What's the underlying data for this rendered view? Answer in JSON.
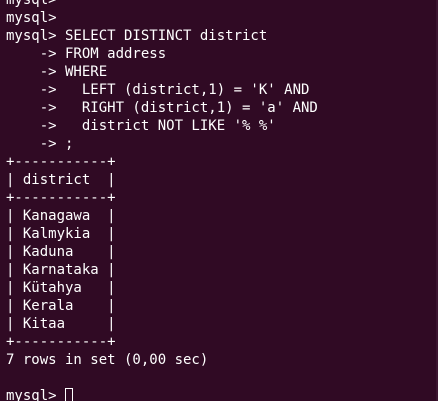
{
  "terminal": {
    "lines": [
      "mysql>",
      "mysql>",
      "mysql> SELECT DISTINCT district",
      "    -> FROM address",
      "    -> WHERE",
      "    ->   LEFT (district,1) = 'K' AND",
      "    ->   RIGHT (district,1) = 'a' AND",
      "    ->   district NOT LIKE '% %'",
      "    -> ;",
      "+-----------+",
      "| district  |",
      "+-----------+",
      "| Kanagawa  |",
      "| Kalmykia  |",
      "| Kaduna    |",
      "| Karnataka |",
      "| Kütahya   |",
      "| Kerala    |",
      "| Kitaa     |",
      "+-----------+",
      "7 rows in set (0,00 sec)",
      ""
    ],
    "prompt": "mysql> "
  }
}
